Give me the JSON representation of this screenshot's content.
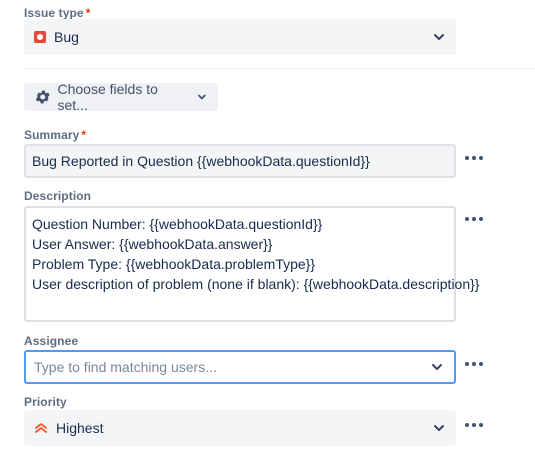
{
  "issue_type": {
    "label": "Issue type",
    "required_mark": "*",
    "value": "Bug",
    "icon": "bug-icon"
  },
  "choose_fields": {
    "label": "Choose fields to set...",
    "icon": "gear-icon"
  },
  "summary": {
    "label": "Summary",
    "required_mark": "*",
    "value": "Bug Reported in Question {{webhookData.questionId}}"
  },
  "description": {
    "label": "Description",
    "lines": [
      "Question Number: {{webhookData.questionId}}",
      "User Answer: {{webhookData.answer}}",
      "Problem Type: {{webhookData.problemType}}",
      "User description of problem (none if blank): {{webhookData.description}}"
    ]
  },
  "assignee": {
    "label": "Assignee",
    "value": "",
    "placeholder": "Type to find matching users..."
  },
  "priority": {
    "label": "Priority",
    "value": "Highest",
    "icon": "priority-highest-icon",
    "icon_color": "#ff5630"
  },
  "colors": {
    "required": "#de350b",
    "focus_border": "#4c9aff",
    "bug": "#e5493a"
  }
}
